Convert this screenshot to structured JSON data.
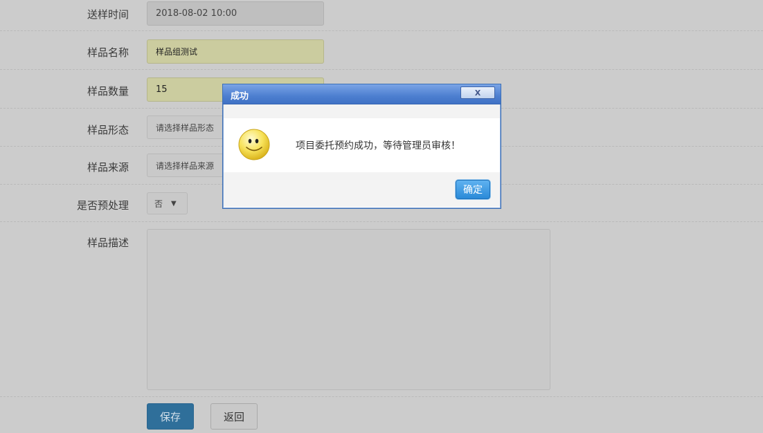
{
  "form": {
    "send_time": {
      "label": "送样时间",
      "value": "2018-08-02 10:00"
    },
    "sample_name": {
      "label": "样品名称",
      "value": "样品组测试"
    },
    "sample_quantity": {
      "label": "样品数量",
      "value": "15"
    },
    "sample_form": {
      "label": "样品形态",
      "placeholder": "请选择样品形态"
    },
    "sample_source": {
      "label": "样品来源",
      "placeholder": "请选择样品来源"
    },
    "pretreatment": {
      "label": "是否预处理",
      "selected": "否"
    },
    "description": {
      "label": "样品描述",
      "value": ""
    }
  },
  "actions": {
    "save_label": "保存",
    "back_label": "返回"
  },
  "dialog": {
    "title": "成功",
    "close_label": "X",
    "message": "项目委托预约成功，等待管理员审核！",
    "ok_label": "确定",
    "icon": "smiley-icon"
  }
}
